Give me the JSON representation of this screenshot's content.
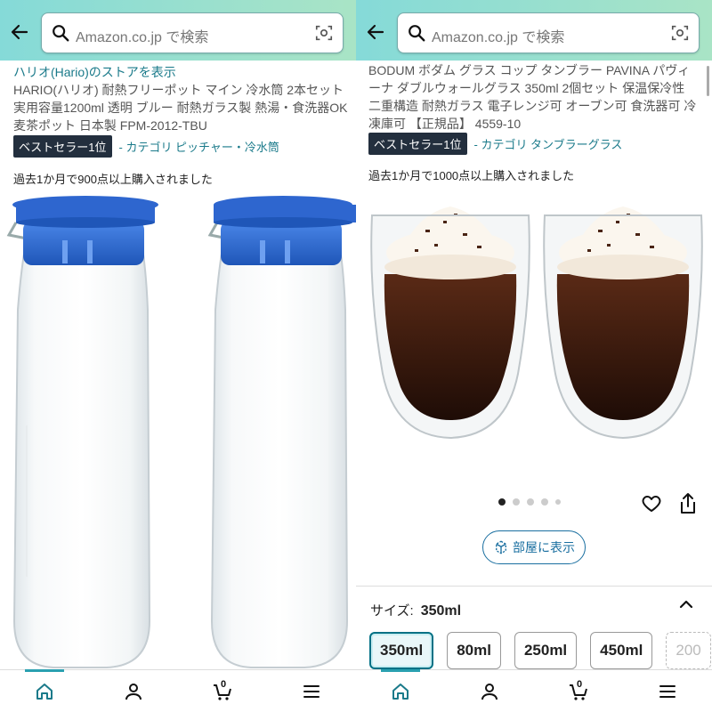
{
  "left": {
    "search": {
      "placeholder": "Amazon.co.jp で検索"
    },
    "store_link": "ハリオ(Hario)のストアを表示",
    "title": "HARIO(ハリオ) 耐熱フリーポット マイン 冷水筒 2本セット 実用容量1200ml 透明 ブルー 耐熱ガラス製 熱湯・食洗器OK 麦茶ポット 日本製 FPM-2012-TBU",
    "badge": "ベストセラー1位",
    "category": "- カテゴリ ピッチャー・冷水筒",
    "bought": "過去1か月で900点以上購入されました",
    "image_icon": "glass-pitcher-pair",
    "accent": "#2a62c9"
  },
  "right": {
    "search": {
      "placeholder": "Amazon.co.jp で検索"
    },
    "title": "BODUM ボダム グラス コップ タンブラー PAVINA パヴィーナ ダブルウォールグラス 350ml 2個セット 保温保冷性 二重構造 耐熱ガラス 電子レンジ可 オーブン可 食洗器可 冷凍庫可 【正規品】 4559-10",
    "badge": "ベストセラー1位",
    "category": "- カテゴリ タンブラーグラス",
    "bought": "過去1か月で1000点以上購入されました",
    "image_icon": "double-wall-glass-pair",
    "carousel": {
      "count": 5,
      "active": 0
    },
    "room_button": "部屋に表示",
    "size": {
      "label": "サイズ:",
      "selected": "350ml",
      "options": [
        "350ml",
        "80ml",
        "250ml",
        "450ml",
        "200"
      ]
    }
  },
  "tabbar": {
    "cart_count": "0",
    "icons": [
      "home-icon",
      "account-icon",
      "cart-icon",
      "menu-icon"
    ]
  },
  "colors": {
    "header_start": "#85dad8",
    "header_end": "#a9e4c6",
    "link": "#1a7a8a",
    "badge_bg": "#232f3e",
    "selected_border": "#007185"
  }
}
